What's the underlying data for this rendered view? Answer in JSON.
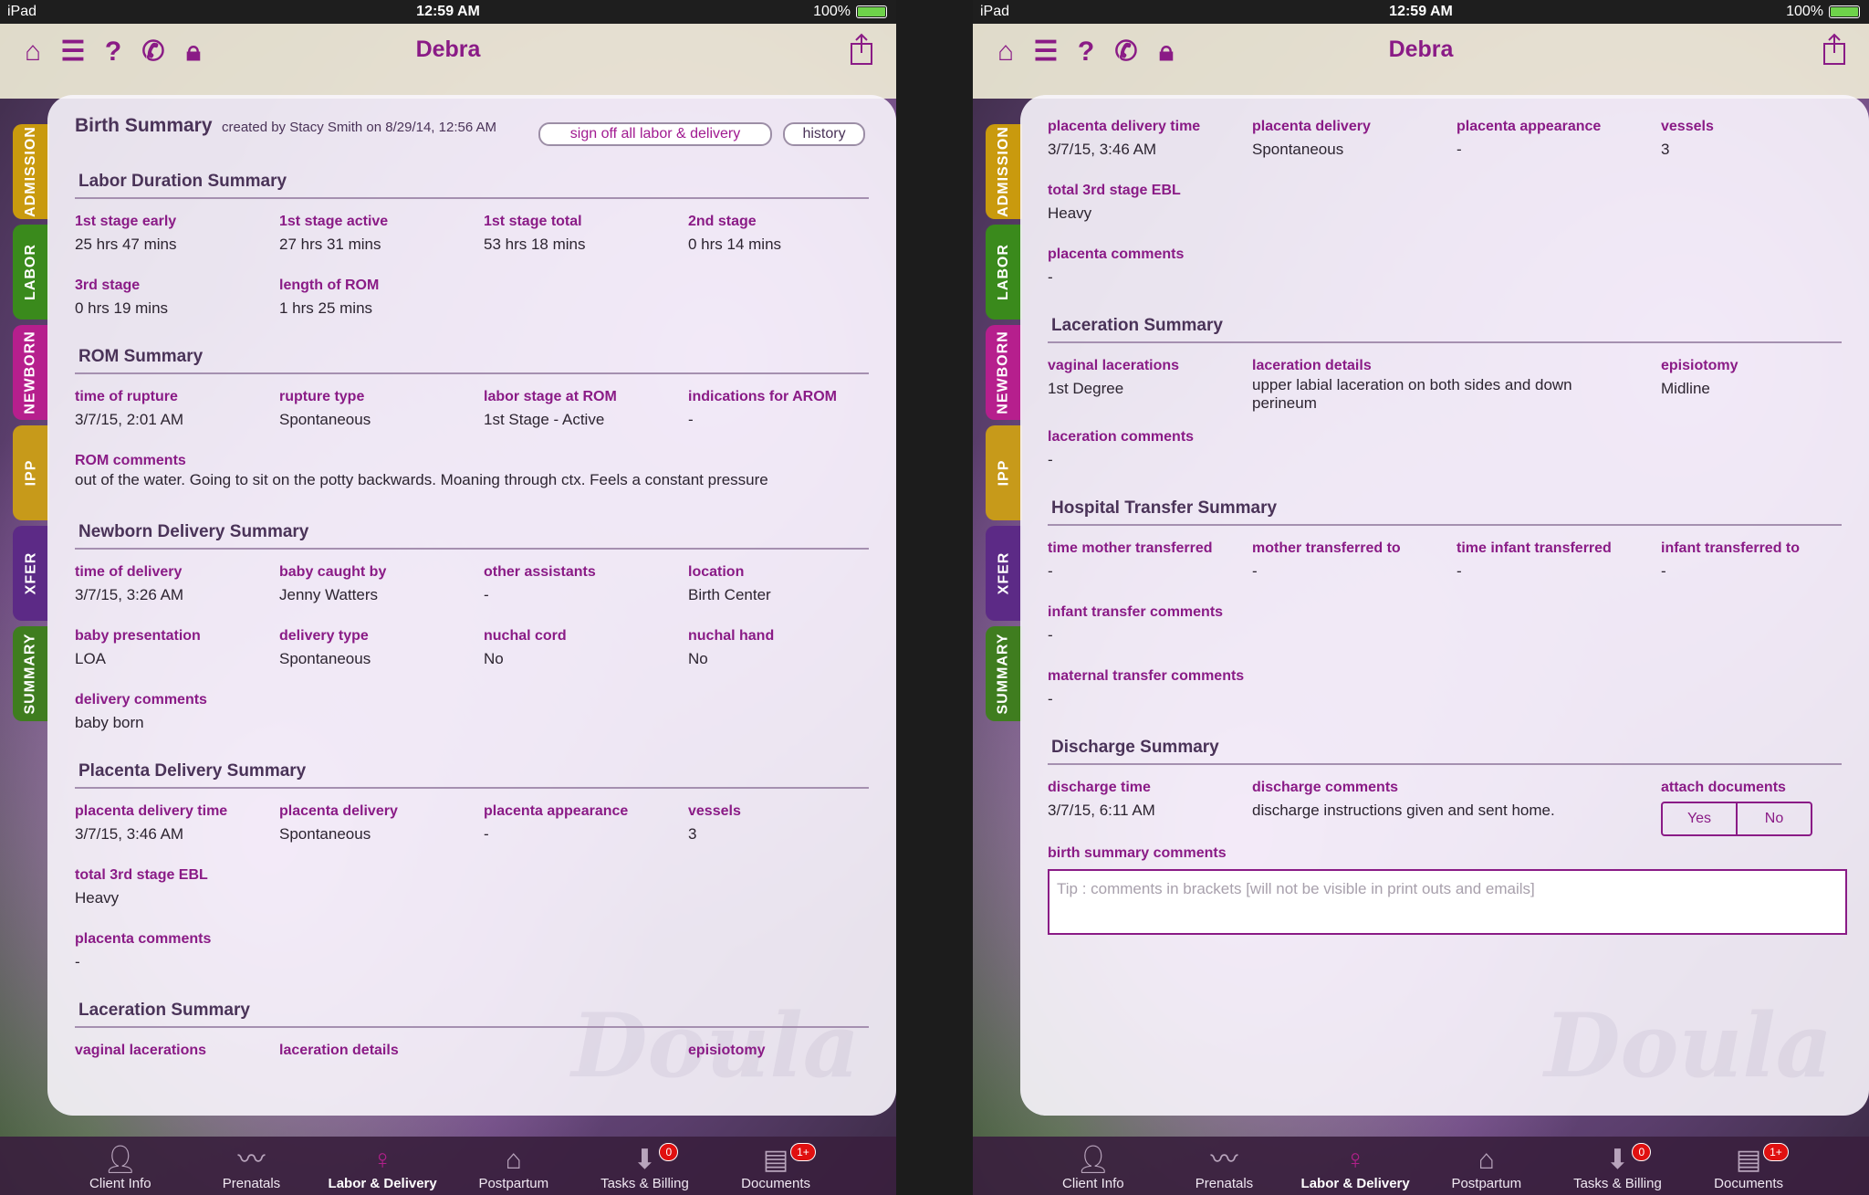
{
  "status": {
    "device": "iPad",
    "time": "12:59 AM",
    "battery": "100%"
  },
  "nav": {
    "title": "Debra"
  },
  "side_tabs": [
    "ADMISSION",
    "LABOR",
    "NEWBORN",
    "IPP",
    "XFER",
    "SUMMARY"
  ],
  "tabbar": [
    {
      "label": "Client Info",
      "icon": "person-icon",
      "badge": ""
    },
    {
      "label": "Prenatals",
      "icon": "pulse-icon",
      "badge": ""
    },
    {
      "label": "Labor & Delivery",
      "icon": "mother-icon",
      "badge": "",
      "active": true
    },
    {
      "label": "Postpartum",
      "icon": "house-icon",
      "badge": ""
    },
    {
      "label": "Tasks & Billing",
      "icon": "inbox-icon",
      "badge": "0"
    },
    {
      "label": "Documents",
      "icon": "documents-icon",
      "badge": "1+"
    }
  ],
  "left": {
    "title": "Birth Summary",
    "created": "created by Stacy Smith on 8/29/14, 12:56 AM",
    "signoff_label": "sign off all labor & delivery",
    "history_label": "history",
    "labor_duration": {
      "title": "Labor Duration Summary",
      "fields": [
        {
          "label": "1st stage early",
          "value": "25 hrs  47 mins"
        },
        {
          "label": "1st stage active",
          "value": "27 hrs  31 mins"
        },
        {
          "label": "1st stage total",
          "value": "53 hrs  18 mins"
        },
        {
          "label": "2nd stage",
          "value": "0 hrs  14 mins"
        },
        {
          "label": "3rd stage",
          "value": "0 hrs  19 mins"
        },
        {
          "label": "length of ROM",
          "value": "1 hrs  25 mins"
        }
      ]
    },
    "rom": {
      "title": "ROM Summary",
      "fields": [
        {
          "label": "time of rupture",
          "value": "3/7/15, 2:01 AM"
        },
        {
          "label": "rupture type",
          "value": "Spontaneous"
        },
        {
          "label": "labor stage at ROM",
          "value": "1st Stage - Active"
        },
        {
          "label": "indications for AROM",
          "value": "-"
        }
      ],
      "comments_label": "ROM comments",
      "comments": "out of the water.  Going to sit on the potty backwards.  Moaning through ctx.  Feels a constant pressure"
    },
    "newborn": {
      "title": "Newborn Delivery Summary",
      "fields": [
        {
          "label": "time of delivery",
          "value": "3/7/15, 3:26 AM"
        },
        {
          "label": "baby caught by",
          "value": "Jenny Watters"
        },
        {
          "label": "other assistants",
          "value": "-"
        },
        {
          "label": "location",
          "value": "Birth Center"
        },
        {
          "label": "baby presentation",
          "value": "LOA"
        },
        {
          "label": "delivery type",
          "value": "Spontaneous"
        },
        {
          "label": "nuchal cord",
          "value": "No"
        },
        {
          "label": "nuchal hand",
          "value": "No"
        }
      ],
      "comments_label": "delivery comments",
      "comments": "baby born"
    },
    "placenta": {
      "title": "Placenta Delivery Summary",
      "fields": [
        {
          "label": "placenta delivery time",
          "value": "3/7/15, 3:46 AM"
        },
        {
          "label": "placenta delivery",
          "value": "Spontaneous"
        },
        {
          "label": "placenta appearance",
          "value": "-"
        },
        {
          "label": "vessels",
          "value": "3"
        }
      ],
      "ebl_label": "total 3rd stage EBL",
      "ebl": "Heavy",
      "comments_label": "placenta comments",
      "comments": "-"
    },
    "laceration": {
      "title": "Laceration Summary",
      "labels": [
        "vaginal lacerations",
        "laceration details",
        "",
        "episiotomy"
      ]
    }
  },
  "right": {
    "placenta": {
      "fields": [
        {
          "label": "placenta delivery time",
          "value": "3/7/15, 3:46 AM"
        },
        {
          "label": "placenta delivery",
          "value": "Spontaneous"
        },
        {
          "label": "placenta appearance",
          "value": "-"
        },
        {
          "label": "vessels",
          "value": "3"
        }
      ],
      "ebl_label": "total 3rd stage EBL",
      "ebl": "Heavy",
      "comments_label": "placenta comments",
      "comments": "-"
    },
    "laceration": {
      "title": "Laceration Summary",
      "vaginal_label": "vaginal lacerations",
      "vaginal": "1st Degree",
      "details_label": "laceration details",
      "details": "upper labial laceration on both sides and down perineum",
      "episiotomy_label": "episiotomy",
      "episiotomy": "Midline",
      "comments_label": "laceration comments",
      "comments": "-"
    },
    "transfer": {
      "title": "Hospital Transfer Summary",
      "fields": [
        {
          "label": "time mother transferred",
          "value": "-"
        },
        {
          "label": "mother transferred to",
          "value": "-"
        },
        {
          "label": "time infant transferred",
          "value": "-"
        },
        {
          "label": "infant transferred to",
          "value": "-"
        }
      ],
      "infant_comments_label": "infant transfer comments",
      "infant_comments": "-",
      "maternal_comments_label": "maternal transfer comments",
      "maternal_comments": "-"
    },
    "discharge": {
      "title": "Discharge Summary",
      "time_label": "discharge time",
      "time": "3/7/15, 6:11 AM",
      "comments_label": "discharge comments",
      "comments": "discharge instructions given and sent home.",
      "attach_label": "attach documents",
      "yes": "Yes",
      "no": "No"
    },
    "birth_comments_label": "birth summary comments",
    "birth_comments_placeholder": "Tip : comments in brackets [will not be visible in print outs and emails]"
  }
}
